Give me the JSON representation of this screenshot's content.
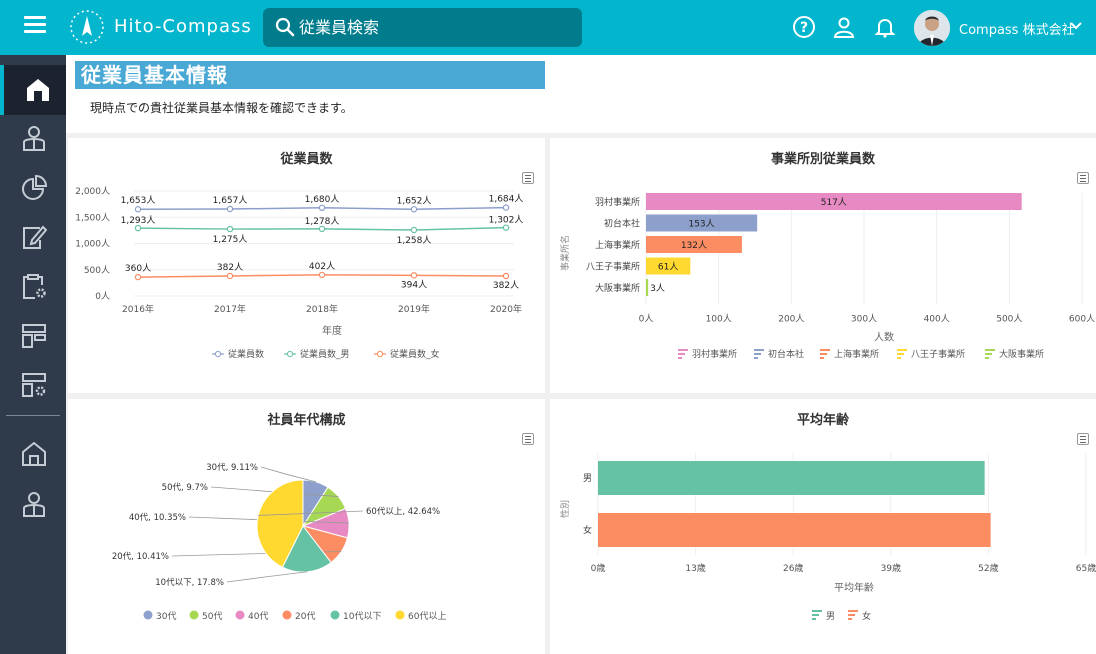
{
  "header": {
    "app_name": "Hito-Compass",
    "search_placeholder": "従業員検索",
    "company": "Compass 株式会社"
  },
  "page": {
    "title": "従業員基本情報",
    "description": "現時点での貴社従業員基本情報を確認できます。"
  },
  "panels": {
    "employees": "従業員数",
    "by_office": "事業所別従業員数",
    "age_comp": "社員年代構成",
    "avg_age": "平均年齢"
  },
  "colors": {
    "accent": "#03b6cd",
    "sidebar": "#2f3a4a"
  },
  "chart_data": [
    {
      "type": "line",
      "title": "従業員数",
      "xlabel": "年度",
      "ylabel": "",
      "x": [
        "2016年",
        "2017年",
        "2018年",
        "2019年",
        "2020年"
      ],
      "y_ticks": [
        "0人",
        "500人",
        "1,000人",
        "1,500人",
        "2,000人"
      ],
      "ylim": [
        0,
        2000
      ],
      "series": [
        {
          "name": "従業員数",
          "color": "#8c9fcc",
          "values": [
            1653,
            1657,
            1680,
            1652,
            1684
          ],
          "labels": [
            "1,653人",
            "1,657人",
            "1,680人",
            "1,652人",
            "1,684人"
          ]
        },
        {
          "name": "従業員数_男",
          "color": "#66c2a5",
          "values": [
            1293,
            1275,
            1278,
            1258,
            1302
          ],
          "labels": [
            "1,293人",
            "1,275人",
            "1,278人",
            "1,258人",
            "1,302人"
          ]
        },
        {
          "name": "従業員数_女",
          "color": "#fc8d62",
          "values": [
            360,
            382,
            402,
            394,
            382
          ],
          "labels": [
            "360人",
            "382人",
            "402人",
            "394人",
            "382人"
          ]
        }
      ]
    },
    {
      "type": "bar",
      "orientation": "horizontal",
      "title": "事業所別従業員数",
      "xlabel": "人数",
      "ylabel": "事業所名",
      "categories": [
        "羽村事業所",
        "初台本社",
        "上海事業所",
        "八王子事業所",
        "大阪事業所"
      ],
      "values": [
        517,
        153,
        132,
        61,
        3
      ],
      "labels": [
        "517人",
        "153人",
        "132人",
        "61人",
        "3人"
      ],
      "colors": [
        "#e78ac3",
        "#8da0cb",
        "#fc8d62",
        "#ffd92f",
        "#a6d854"
      ],
      "x_ticks": [
        "0人",
        "100人",
        "200人",
        "300人",
        "400人",
        "500人",
        "600人"
      ],
      "xlim": [
        0,
        600
      ]
    },
    {
      "type": "pie",
      "title": "社員年代構成",
      "categories": [
        "30代",
        "50代",
        "40代",
        "20代",
        "10代以下",
        "60代以上"
      ],
      "values": [
        9.11,
        9.7,
        10.35,
        10.41,
        17.8,
        42.64
      ],
      "labels": [
        "30代, 9.11%",
        "50代, 9.7%",
        "40代, 10.35%",
        "20代, 10.41%",
        "10代以下, 17.8%",
        "60代以上, 42.64%"
      ],
      "colors": [
        "#8da0cb",
        "#a6d854",
        "#e78ac3",
        "#fc8d62",
        "#66c2a5",
        "#ffd92f"
      ],
      "legend": [
        "30代",
        "50代",
        "40代",
        "20代",
        "10代以下",
        "60代以上"
      ]
    },
    {
      "type": "bar",
      "orientation": "horizontal",
      "title": "平均年齢",
      "xlabel": "平均年齢",
      "ylabel": "性別",
      "categories": [
        "男",
        "女"
      ],
      "values": [
        51.5,
        52.3
      ],
      "colors": [
        "#66c2a5",
        "#fc8d62"
      ],
      "x_ticks": [
        "0歳",
        "13歳",
        "26歳",
        "39歳",
        "52歳",
        "65歳"
      ],
      "xlim": [
        0,
        65
      ]
    }
  ]
}
